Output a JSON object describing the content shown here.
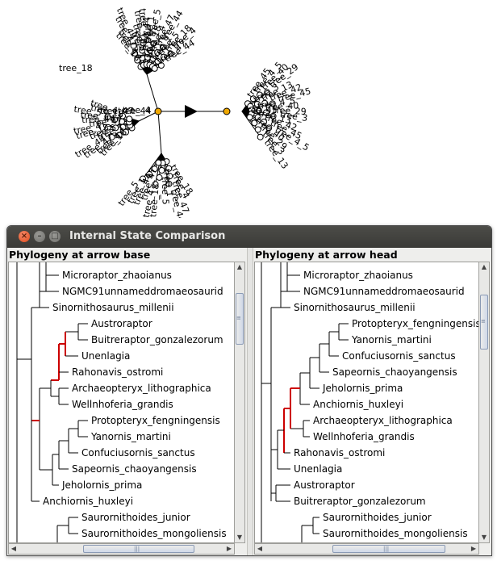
{
  "window": {
    "title": "Internal State Comparison"
  },
  "colors": {
    "highlight": "#cc0000",
    "node_fill": "#f0a800"
  },
  "top_labels": {
    "left_cluster": [
      "tree_18",
      "tree_4",
      "tree_47",
      "tree_44",
      "tree_1",
      "tree_5"
    ],
    "right_cluster": [
      "tree_45",
      "tree_4_5",
      "tree_40",
      "tree_29",
      "tree_3",
      "tree_13",
      "tree_42"
    ]
  },
  "panels": {
    "left": {
      "title": "Phylogeny at arrow base",
      "taxa": [
        "Microraptor_zhaoianus",
        "NGMC91unnameddromaeosaurid",
        "Sinornithosaurus_millenii",
        "Austroraptor",
        "Buitreraptor_gonzalezorum",
        "Unenlagia",
        "Rahonavis_ostromi",
        "Archaeopteryx_lithographica",
        "Wellnhoferia_grandis",
        "Protopteryx_fengningensis",
        "Yanornis_martini",
        "Confuciusornis_sanctus",
        "Sapeornis_chaoyangensis",
        "Jeholornis_prima",
        "Anchiornis_huxleyi",
        "Saurornithoides_junior",
        "Saurornithoides_mongoliensis"
      ]
    },
    "right": {
      "title": "Phylogeny at arrow head",
      "taxa": [
        "Microraptor_zhaoianus",
        "NGMC91unnameddromaeosaurid",
        "Sinornithosaurus_millenii",
        "Protopteryx_fengningensis",
        "Yanornis_martini",
        "Confuciusornis_sanctus",
        "Sapeornis_chaoyangensis",
        "Jeholornis_prima",
        "Anchiornis_huxleyi",
        "Archaeopteryx_lithographica",
        "Wellnhoferia_grandis",
        "Rahonavis_ostromi",
        "Unenlagia",
        "Austroraptor",
        "Buitreraptor_gonzalezorum",
        "Saurornithoides_junior",
        "Saurornithoides_mongoliensis"
      ]
    }
  }
}
